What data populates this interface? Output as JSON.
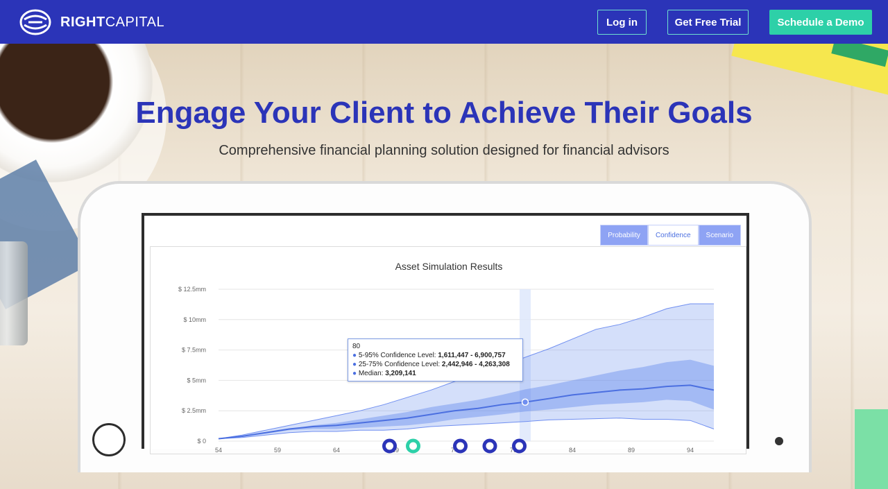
{
  "brand": {
    "name_bold": "RIGHT",
    "name_light": "CAPITAL"
  },
  "nav": {
    "login": "Log in",
    "trial": "Get Free Trial",
    "demo": "Schedule a Demo"
  },
  "colors": {
    "primary": "#2b34b8",
    "accent": "#2dd0a8",
    "chart_blue": "#4b6fe0"
  },
  "hero": {
    "title": "Engage Your Client to Achieve Their Goals",
    "subtitle": "Comprehensive financial planning solution designed for financial advisors"
  },
  "tabs": [
    "Probability",
    "Confidence",
    "Scenario"
  ],
  "active_tab": "Confidence",
  "tooltip": {
    "age": "80",
    "l1": "5-95% Confidence Level: ",
    "v1": "1,611,447 - 6,900,757",
    "l2": "25-75% Confidence Level: ",
    "v2": "2,442,946 - 4,263,308",
    "l3": "Median: ",
    "v3": "3,209,141"
  },
  "chart_data": {
    "type": "area",
    "title": "Asset Simulation Results",
    "y_tick_labels": [
      "$ 0",
      "$ 2.5mm",
      "$ 5mm",
      "$ 7.5mm",
      "$ 10mm",
      "$ 12.5mm"
    ],
    "y_ticks": [
      0,
      2.5,
      5,
      7.5,
      10,
      12.5
    ],
    "ylim": [
      0,
      12.5
    ],
    "x_tick_labels": [
      "54",
      "59",
      "64",
      "69",
      "74",
      "79",
      "84",
      "89",
      "94"
    ],
    "xlim": [
      54,
      96
    ],
    "highlight_x": 80,
    "x": [
      54,
      56,
      58,
      60,
      62,
      64,
      66,
      68,
      70,
      72,
      74,
      76,
      78,
      80,
      82,
      84,
      86,
      88,
      90,
      92,
      94,
      96
    ],
    "p95": [
      0.2,
      0.5,
      0.9,
      1.3,
      1.7,
      2.1,
      2.5,
      3.0,
      3.6,
      4.2,
      4.9,
      5.6,
      6.2,
      6.9,
      7.6,
      8.4,
      9.2,
      9.6,
      10.2,
      10.9,
      11.3,
      11.3
    ],
    "p75": [
      0.2,
      0.4,
      0.7,
      1.0,
      1.3,
      1.5,
      1.8,
      2.1,
      2.4,
      2.8,
      3.1,
      3.4,
      3.8,
      4.26,
      4.6,
      5.0,
      5.4,
      5.8,
      6.1,
      6.5,
      6.7,
      6.2
    ],
    "median": [
      0.2,
      0.4,
      0.7,
      1.0,
      1.2,
      1.3,
      1.5,
      1.7,
      1.9,
      2.2,
      2.5,
      2.7,
      3.0,
      3.21,
      3.5,
      3.8,
      4.0,
      4.2,
      4.3,
      4.5,
      4.6,
      4.2
    ],
    "p25": [
      0.2,
      0.35,
      0.6,
      0.9,
      1.0,
      1.0,
      1.1,
      1.2,
      1.3,
      1.5,
      1.8,
      2.0,
      2.2,
      2.44,
      2.6,
      2.8,
      3.0,
      3.1,
      3.2,
      3.4,
      3.3,
      2.6
    ],
    "p5": [
      0.2,
      0.3,
      0.5,
      0.7,
      0.8,
      0.8,
      0.9,
      0.9,
      1.0,
      1.2,
      1.3,
      1.4,
      1.5,
      1.61,
      1.75,
      1.8,
      1.85,
      1.9,
      1.8,
      1.8,
      1.7,
      1.0
    ],
    "event_markers": [
      {
        "x": 68.5,
        "color": "#2b34b8"
      },
      {
        "x": 70.5,
        "color": "#2dd0a8"
      },
      {
        "x": 74.5,
        "color": "#2b34b8"
      },
      {
        "x": 77,
        "color": "#2b34b8"
      },
      {
        "x": 79.5,
        "color": "#2b34b8"
      }
    ]
  }
}
